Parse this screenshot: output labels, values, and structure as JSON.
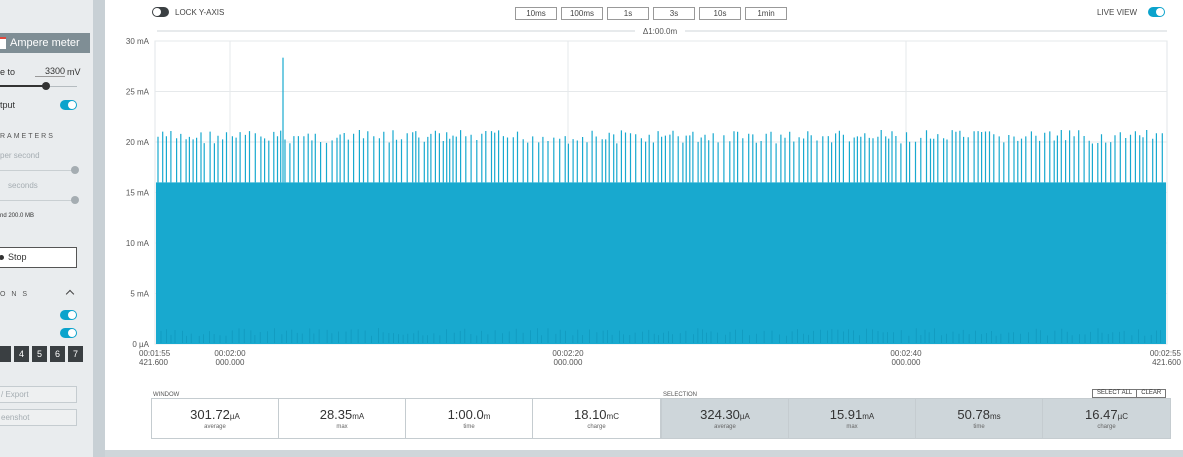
{
  "sidebar": {
    "meter_button": "Ampere meter",
    "voltage_label": "e to",
    "voltage_value": "3300",
    "voltage_unit": "mV",
    "output_label": "tput",
    "params_heading": "RAMETERS",
    "rate_label": "per second",
    "duration_label": "seconds",
    "storage_text": "nd 200.0 MB",
    "stop_label": "Stop",
    "options_heading": "O N S",
    "digits": [
      "4",
      "5",
      "6",
      "7"
    ],
    "export_label": "/ Export",
    "screenshot_label": "eenshot"
  },
  "toolbar": {
    "lock_label": "LOCK Y-AXIS",
    "window_buttons": [
      "10ms",
      "100ms",
      "1s",
      "3s",
      "10s",
      "1min"
    ],
    "live_label": "LIVE VIEW",
    "accent": "#0ba3cc"
  },
  "chart_data": {
    "type": "area",
    "ylim": [
      0,
      30
    ],
    "y_unit": "mA",
    "y_ticks": [
      "30 mA",
      "25 mA",
      "20 mA",
      "15 mA",
      "10 mA",
      "5 mA",
      "0 µA"
    ],
    "x_ticks": [
      {
        "time": "00:01:55",
        "sub": "421.600"
      },
      {
        "time": "00:02:00",
        "sub": "000.000"
      },
      {
        "time": "00:02:20",
        "sub": "000.000"
      },
      {
        "time": "00:02:40",
        "sub": "000.000"
      },
      {
        "time": "00:02:55",
        "sub": "421.600"
      }
    ],
    "span_label": "Δ1:00.0m",
    "series_color": "#18a9cf",
    "baseline_mA": 16.0,
    "peak_mA": 20.5,
    "max_mA": 28.35,
    "grid": true
  },
  "stats": {
    "window_title": "WINDOW",
    "selection_title": "SELECTION",
    "select_all": "SELECT ALL",
    "clear": "CLEAR",
    "window": [
      {
        "value": "301.72",
        "unit": "µA",
        "label": "average"
      },
      {
        "value": "28.35",
        "unit": "mA",
        "label": "max"
      },
      {
        "value": "1:00.0",
        "unit": "m",
        "label": "time"
      },
      {
        "value": "18.10",
        "unit": "mC",
        "label": "charge"
      }
    ],
    "selection": [
      {
        "value": "324.30",
        "unit": "µA",
        "label": "average"
      },
      {
        "value": "15.91",
        "unit": "mA",
        "label": "max"
      },
      {
        "value": "50.78",
        "unit": "ms",
        "label": "time"
      },
      {
        "value": "16.47",
        "unit": "µC",
        "label": "charge"
      }
    ]
  }
}
